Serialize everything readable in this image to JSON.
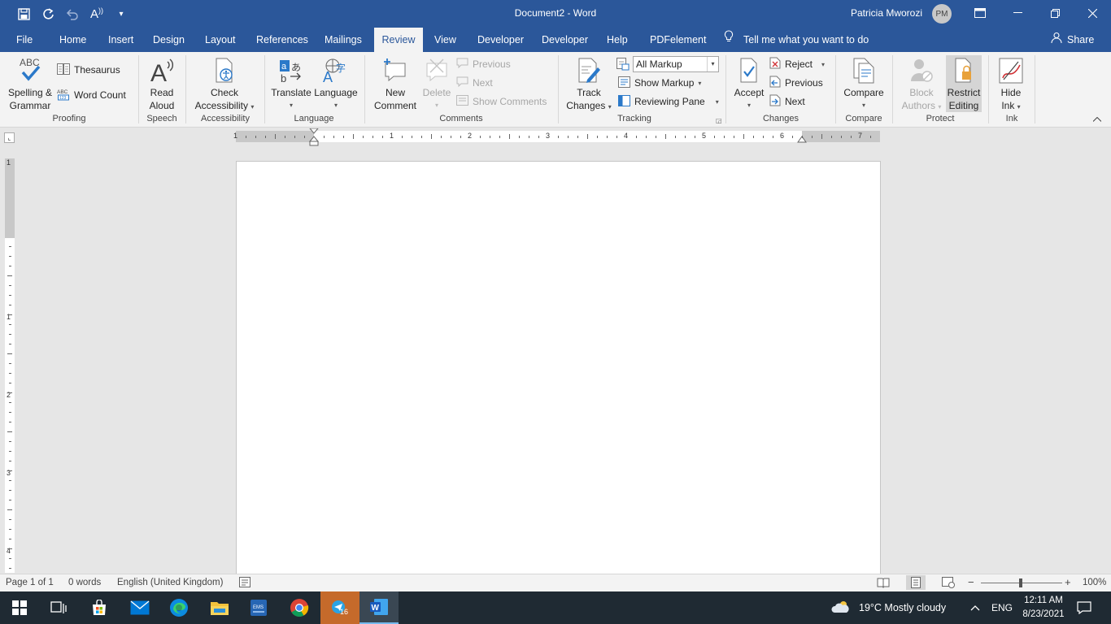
{
  "title_bar": {
    "document_title": "Document2  -  Word",
    "user_name": "Patricia Mworozi",
    "user_initials": "PM",
    "quick_access": [
      {
        "name": "save-icon",
        "glyph": "🖫"
      },
      {
        "name": "redo-icon",
        "glyph": "↻"
      },
      {
        "name": "undo-icon",
        "glyph": "↶"
      },
      {
        "name": "read-aloud-qat-icon",
        "glyph": "A⁾"
      },
      {
        "name": "customize-qat-icon",
        "glyph": "▾"
      }
    ],
    "window_controls": {
      "ribbon_display": "⊟",
      "minimize": "—",
      "restore": "❐",
      "close": "✕"
    }
  },
  "tabs": [
    {
      "label": "File"
    },
    {
      "label": "Home"
    },
    {
      "label": "Insert"
    },
    {
      "label": "Design"
    },
    {
      "label": "Layout"
    },
    {
      "label": "References"
    },
    {
      "label": "Mailings"
    },
    {
      "label": "Review"
    },
    {
      "label": "View"
    },
    {
      "label": "Developer"
    },
    {
      "label": "Developer"
    },
    {
      "label": "Help"
    },
    {
      "label": "PDFelement"
    }
  ],
  "active_tab": "Review",
  "tell_me": "Tell me what you want to do",
  "share": "Share",
  "ribbon": {
    "proofing": {
      "label": "Proofing",
      "spelling_line1": "Spelling &",
      "spelling_line2": "Grammar",
      "abc": "ABC",
      "thesaurus": "Thesaurus",
      "word_count": "Word Count"
    },
    "speech": {
      "label": "Speech",
      "read_line1": "Read",
      "read_line2": "Aloud"
    },
    "accessibility": {
      "label": "Accessibility",
      "check_line1": "Check",
      "check_line2": "Accessibility"
    },
    "language": {
      "label": "Language",
      "translate": "Translate",
      "language": "Language"
    },
    "comments": {
      "label": "Comments",
      "new_line1": "New",
      "new_line2": "Comment",
      "delete": "Delete",
      "previous": "Previous",
      "next": "Next",
      "show_comments": "Show Comments"
    },
    "tracking": {
      "label": "Tracking",
      "track_line1": "Track",
      "track_line2": "Changes",
      "markup_value": "All Markup",
      "show_markup": "Show Markup",
      "reviewing_pane": "Reviewing Pane"
    },
    "changes": {
      "label": "Changes",
      "accept": "Accept",
      "reject": "Reject",
      "previous": "Previous",
      "next": "Next"
    },
    "compare": {
      "label": "Compare",
      "compare": "Compare"
    },
    "protect": {
      "label": "Protect",
      "block_line1": "Block",
      "block_line2": "Authors",
      "restrict_line1": "Restrict",
      "restrict_line2": "Editing"
    },
    "ink": {
      "label": "Ink",
      "hide_line1": "Hide",
      "hide_line2": "Ink"
    }
  },
  "ruler": {
    "h_numbers": [
      "1",
      "1",
      "2",
      "3",
      "4",
      "5",
      "6",
      "7"
    ],
    "v_numbers": [
      "1",
      "1",
      "2",
      "3",
      "4"
    ]
  },
  "status_bar": {
    "page": "Page 1 of 1",
    "words": "0 words",
    "language": "English (United Kingdom)",
    "zoom": "100%",
    "zoom_minus": "−",
    "zoom_plus": "+"
  },
  "taskbar": {
    "weather": "19°C  Mostly cloudy",
    "lang": "ENG",
    "time": "12:11 AM",
    "date": "8/23/2021",
    "badge": "16"
  }
}
